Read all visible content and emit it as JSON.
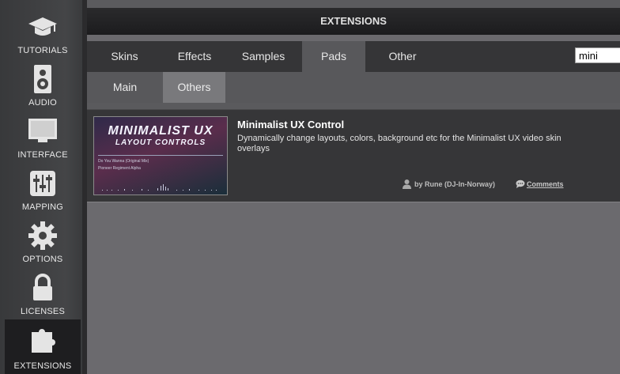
{
  "header": {
    "title": "EXTENSIONS"
  },
  "sidebar": {
    "items": [
      {
        "label": "TUTORIALS",
        "icon": "graduation-cap-icon"
      },
      {
        "label": "AUDIO",
        "icon": "speaker-icon"
      },
      {
        "label": "INTERFACE",
        "icon": "monitor-icon"
      },
      {
        "label": "MAPPING",
        "icon": "sliders-icon"
      },
      {
        "label": "OPTIONS",
        "icon": "gear-icon"
      },
      {
        "label": "LICENSES",
        "icon": "lock-icon"
      },
      {
        "label": "EXTENSIONS",
        "icon": "puzzle-icon",
        "active": true
      }
    ]
  },
  "tabs": {
    "primary": [
      "Skins",
      "Effects",
      "Samples",
      "Pads",
      "Other"
    ],
    "primary_active": "Pads",
    "secondary": [
      "Main",
      "Others"
    ],
    "secondary_active": "Others"
  },
  "search": {
    "value": "mini"
  },
  "extension": {
    "title": "Minimalist UX Control",
    "description": "Dynamically change layouts, colors, background etc for the Minimalist UX video skin overlays",
    "author": "by Rune (DJ-In-Norway)",
    "comments": "Comments",
    "thumbnail": {
      "title": "MINIMALIST UX",
      "subtitle": "LAYOUT CONTROLS",
      "line1": "Do You Wanna (Original Mix)",
      "line2": "Pioneer Regiment Alpha"
    }
  },
  "colors": {
    "active_tab": "#58585b",
    "active_subtab": "#79797c",
    "sidebar_active": "#1e1e20"
  }
}
